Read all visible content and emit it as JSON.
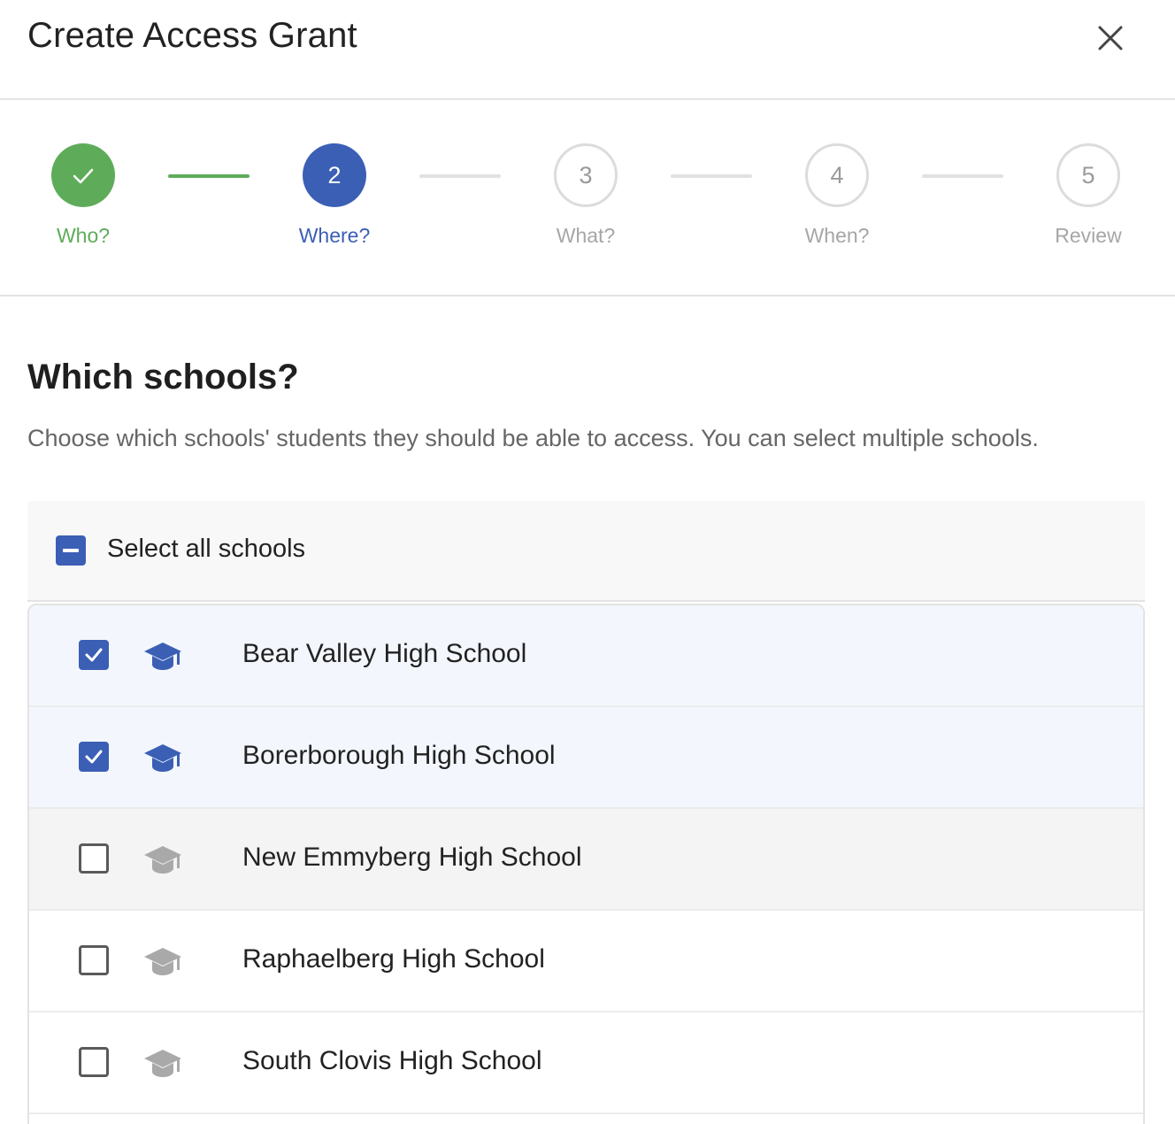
{
  "dialog": {
    "title": "Create Access Grant",
    "close_icon": "close-icon"
  },
  "stepper": {
    "steps": [
      {
        "number": "1",
        "label": "Who?",
        "state": "done",
        "icon": "check-icon"
      },
      {
        "number": "2",
        "label": "Where?",
        "state": "active"
      },
      {
        "number": "3",
        "label": "What?",
        "state": "pending"
      },
      {
        "number": "4",
        "label": "When?",
        "state": "pending"
      },
      {
        "number": "5",
        "label": "Review",
        "state": "pending"
      }
    ],
    "colors": {
      "done": "#5eac5a",
      "active": "#3b5fb5",
      "pending": "#a6a6a6"
    }
  },
  "section": {
    "heading": "Which schools?",
    "description": "Choose which schools' students they should be able to access. You can select multiple schools."
  },
  "select_all": {
    "label": "Select all schools",
    "state": "indeterminate"
  },
  "schools": [
    {
      "name": "Bear Valley High School",
      "checked": true,
      "icon": "graduation-cap-icon"
    },
    {
      "name": "Borerborough High School",
      "checked": true,
      "icon": "graduation-cap-icon"
    },
    {
      "name": "New Emmyberg High School",
      "checked": false,
      "icon": "graduation-cap-icon"
    },
    {
      "name": "Raphaelberg High School",
      "checked": false,
      "icon": "graduation-cap-icon"
    },
    {
      "name": "South Clovis High School",
      "checked": false,
      "icon": "graduation-cap-icon"
    }
  ]
}
